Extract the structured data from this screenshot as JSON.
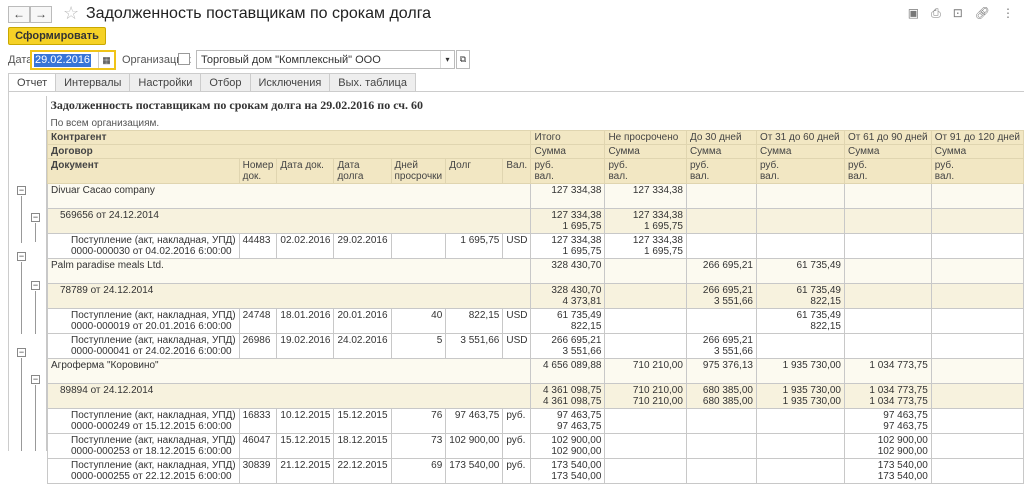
{
  "window": {
    "title": "Задолженность поставщикам по срокам долга",
    "back": "←",
    "forward": "→"
  },
  "toolbar": {
    "generate": "Сформировать"
  },
  "filters": {
    "date_label": "Дата:",
    "date_value": "29.02.2016",
    "org_label": "Организация:",
    "org_value": "Торговый дом \"Комплексный\" ООО"
  },
  "tabs": [
    "Отчет",
    "Интервалы",
    "Настройки",
    "Отбор",
    "Исключения",
    "Вых. таблица"
  ],
  "report": {
    "title": "Задолженность поставщикам по срокам долга на 29.02.2016  по сч. 60",
    "subtitle": "По всем организациям.",
    "h_counterparty": "Контрагент",
    "h_contract": "Договор",
    "h_document": "Документ",
    "h_num": "Номер док.",
    "h_docdate": "Дата док.",
    "h_duedate": "Дата долга",
    "h_days": "Дней просрочки",
    "h_debt": "Долг",
    "h_cur": "Вал.",
    "amount_cols": [
      "Итого",
      "Не просрочено",
      "До 30 дней",
      "От 31 до 60 дней",
      "От 61 до 90 дней",
      "От 91 до 120 дней"
    ],
    "h_sum": "Сумма",
    "h_rub": "руб.",
    "h_val": "вал.",
    "rows": [
      {
        "type": "g1",
        "label": [
          "Divuar Cacao company"
        ],
        "c": [
          "",
          "",
          "",
          "",
          "",
          ""
        ],
        "amt": [
          [
            "127 334,38",
            ""
          ],
          [
            "127 334,38",
            ""
          ],
          [
            "",
            ""
          ],
          [
            "",
            ""
          ],
          [
            "",
            ""
          ],
          [
            "",
            ""
          ]
        ]
      },
      {
        "type": "g2",
        "label": [
          "569656 от 24.12.2014"
        ],
        "c": [
          "",
          "",
          "",
          "",
          "",
          ""
        ],
        "amt": [
          [
            "127 334,38",
            "1 695,75"
          ],
          [
            "127 334,38",
            "1 695,75"
          ],
          [
            "",
            ""
          ],
          [
            "",
            ""
          ],
          [
            "",
            ""
          ],
          [
            "",
            ""
          ]
        ]
      },
      {
        "type": "doc",
        "label": [
          "Поступление (акт, накладная, УПД)",
          "0000-000030 от 04.02.2016 6:00:00"
        ],
        "c": [
          "44483",
          "02.02.2016",
          "29.02.2016",
          "",
          "1 695,75",
          "USD"
        ],
        "amt": [
          [
            "127 334,38",
            "1 695,75"
          ],
          [
            "127 334,38",
            "1 695,75"
          ],
          [
            "",
            ""
          ],
          [
            "",
            ""
          ],
          [
            "",
            ""
          ],
          [
            "",
            ""
          ]
        ]
      },
      {
        "type": "g1",
        "label": [
          "Palm paradise meals Ltd."
        ],
        "c": [
          "",
          "",
          "",
          "",
          "",
          ""
        ],
        "amt": [
          [
            "328 430,70",
            ""
          ],
          [
            "",
            ""
          ],
          [
            "266 695,21",
            ""
          ],
          [
            "61 735,49",
            ""
          ],
          [
            "",
            ""
          ],
          [
            "",
            ""
          ]
        ]
      },
      {
        "type": "g2",
        "label": [
          "78789 от 24.12.2014"
        ],
        "c": [
          "",
          "",
          "",
          "",
          "",
          ""
        ],
        "amt": [
          [
            "328 430,70",
            "4 373,81"
          ],
          [
            "",
            ""
          ],
          [
            "266 695,21",
            "3 551,66"
          ],
          [
            "61 735,49",
            "822,15"
          ],
          [
            "",
            ""
          ],
          [
            "",
            ""
          ]
        ]
      },
      {
        "type": "doc",
        "label": [
          "Поступление (акт, накладная, УПД)",
          "0000-000019 от 20.01.2016 6:00:00"
        ],
        "c": [
          "24748",
          "18.01.2016",
          "20.01.2016",
          "40",
          "822,15",
          "USD"
        ],
        "amt": [
          [
            "61 735,49",
            "822,15"
          ],
          [
            "",
            ""
          ],
          [
            "",
            ""
          ],
          [
            "61 735,49",
            "822,15"
          ],
          [
            "",
            ""
          ],
          [
            "",
            ""
          ]
        ]
      },
      {
        "type": "doc",
        "label": [
          "Поступление (акт, накладная, УПД)",
          "0000-000041 от 24.02.2016 6:00:00"
        ],
        "c": [
          "26986",
          "19.02.2016",
          "24.02.2016",
          "5",
          "3 551,66",
          "USD"
        ],
        "amt": [
          [
            "266 695,21",
            "3 551,66"
          ],
          [
            "",
            ""
          ],
          [
            "266 695,21",
            "3 551,66"
          ],
          [
            "",
            ""
          ],
          [
            "",
            ""
          ],
          [
            "",
            ""
          ]
        ]
      },
      {
        "type": "g1",
        "label": [
          "Агроферма \"Коровино\""
        ],
        "c": [
          "",
          "",
          "",
          "",
          "",
          ""
        ],
        "amt": [
          [
            "4 656 089,88",
            ""
          ],
          [
            "710 210,00",
            ""
          ],
          [
            "975 376,13",
            ""
          ],
          [
            "1 935 730,00",
            ""
          ],
          [
            "1 034 773,75",
            ""
          ],
          [
            "",
            ""
          ]
        ]
      },
      {
        "type": "g2",
        "label": [
          "89894 от 24.12.2014"
        ],
        "c": [
          "",
          "",
          "",
          "",
          "",
          ""
        ],
        "amt": [
          [
            "4 361 098,75",
            "4 361 098,75"
          ],
          [
            "710 210,00",
            "710 210,00"
          ],
          [
            "680 385,00",
            "680 385,00"
          ],
          [
            "1 935 730,00",
            "1 935 730,00"
          ],
          [
            "1 034 773,75",
            "1 034 773,75"
          ],
          [
            "",
            ""
          ]
        ]
      },
      {
        "type": "doc",
        "label": [
          "Поступление (акт, накладная, УПД)",
          "0000-000249 от 15.12.2015 6:00:00"
        ],
        "c": [
          "16833",
          "10.12.2015",
          "15.12.2015",
          "76",
          "97 463,75",
          "руб."
        ],
        "amt": [
          [
            "97 463,75",
            "97 463,75"
          ],
          [
            "",
            ""
          ],
          [
            "",
            ""
          ],
          [
            "",
            ""
          ],
          [
            "97 463,75",
            "97 463,75"
          ],
          [
            "",
            ""
          ]
        ]
      },
      {
        "type": "doc",
        "label": [
          "Поступление (акт, накладная, УПД)",
          "0000-000253 от 18.12.2015 6:00:00"
        ],
        "c": [
          "46047",
          "15.12.2015",
          "18.12.2015",
          "73",
          "102 900,00",
          "руб."
        ],
        "amt": [
          [
            "102 900,00",
            "102 900,00"
          ],
          [
            "",
            ""
          ],
          [
            "",
            ""
          ],
          [
            "",
            ""
          ],
          [
            "102 900,00",
            "102 900,00"
          ],
          [
            "",
            ""
          ]
        ]
      },
      {
        "type": "doc",
        "label": [
          "Поступление (акт, накладная, УПД)",
          "0000-000255 от 22.12.2015 6:00:00"
        ],
        "c": [
          "30839",
          "21.12.2015",
          "22.12.2015",
          "69",
          "173 540,00",
          "руб."
        ],
        "amt": [
          [
            "173 540,00",
            "173 540,00"
          ],
          [
            "",
            ""
          ],
          [
            "",
            ""
          ],
          [
            "",
            ""
          ],
          [
            "173 540,00",
            "173 540,00"
          ],
          [
            "",
            ""
          ]
        ]
      }
    ]
  }
}
